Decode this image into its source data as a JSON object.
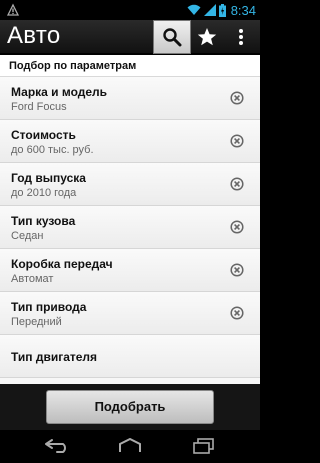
{
  "status_bar": {
    "time": "8:34"
  },
  "action_bar": {
    "title": "Авто"
  },
  "section_title": "Подбор по параметрам",
  "items": [
    {
      "title": "Марка и модель",
      "value": "Ford Focus",
      "clearable": true
    },
    {
      "title": "Стоимость",
      "value": "до 600 тыс. руб.",
      "clearable": true
    },
    {
      "title": "Год выпуска",
      "value": "до 2010 года",
      "clearable": true
    },
    {
      "title": "Тип кузова",
      "value": "Седан",
      "clearable": true
    },
    {
      "title": "Коробка передач",
      "value": "Автомат",
      "clearable": true
    },
    {
      "title": "Тип привода",
      "value": "Передний",
      "clearable": true
    },
    {
      "title": "Тип двигателя",
      "value": "",
      "clearable": false
    }
  ],
  "submit_label": "Подобрать",
  "icons": {
    "status_left": "android-debug-icon",
    "search": "search-icon",
    "favorites": "star-icon",
    "overflow": "overflow-menu-icon",
    "clear": "clear-circle-x-icon",
    "nav_back": "back-icon",
    "nav_home": "home-icon",
    "nav_recent": "recent-apps-icon"
  },
  "colors": {
    "status_time": "#33b5e5",
    "action_bar": "#1a1a1a",
    "list_bg": "#f7f7f7"
  }
}
